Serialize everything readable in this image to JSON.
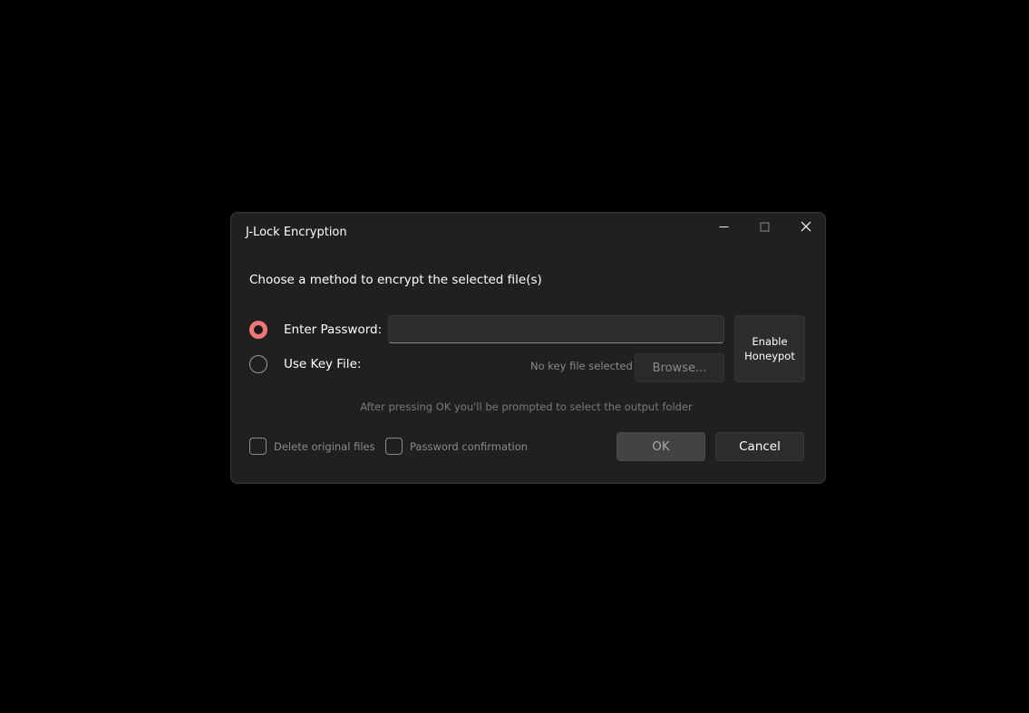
{
  "window": {
    "title": "J-Lock Encryption",
    "controls": {
      "minimize_icon": "minimize-icon",
      "maximize_icon": "maximize-icon",
      "close_icon": "close-icon"
    }
  },
  "prompt": "Choose a method to encrypt the selected file(s)",
  "methods": {
    "selected": "password",
    "password": {
      "label": "Enter Password:",
      "value": "",
      "placeholder": ""
    },
    "keyfile": {
      "label": "Use Key File:",
      "status": "No key file selected",
      "browse_label": "Browse..."
    }
  },
  "honeypot_label": "Enable\nHoneypot",
  "hint": "After pressing OK you'll be prompted to select the output folder",
  "options": {
    "delete_original": {
      "label": "Delete original files",
      "checked": false
    },
    "password_confirmation": {
      "label": "Password confirmation",
      "checked": false
    }
  },
  "actions": {
    "ok_label": "OK",
    "cancel_label": "Cancel"
  },
  "colors": {
    "accent": "#f27777",
    "background": "#202020",
    "page": "#000000"
  }
}
